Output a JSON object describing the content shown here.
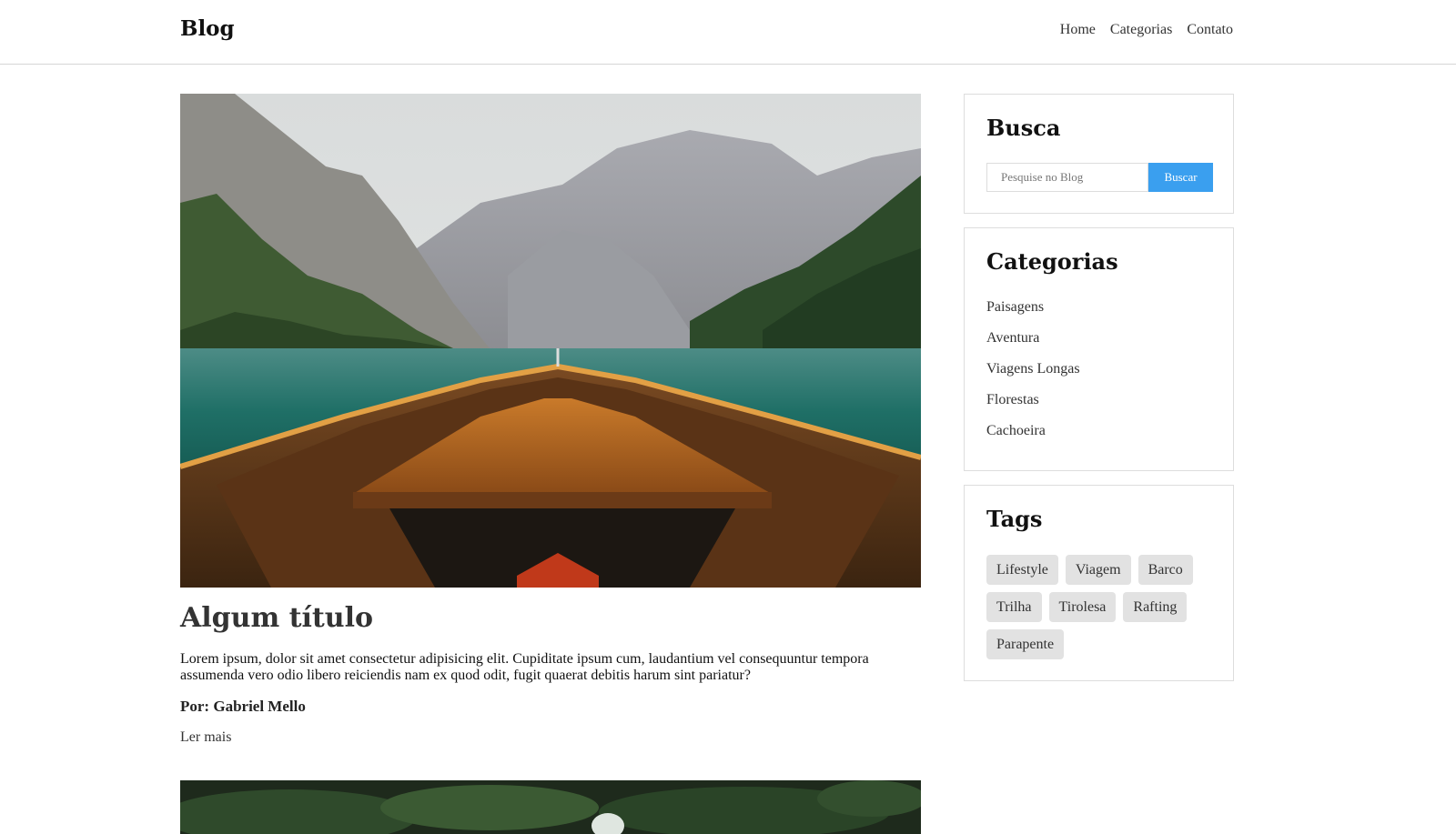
{
  "header": {
    "logo": "Blog",
    "nav": [
      "Home",
      "Categorias",
      "Contato"
    ]
  },
  "post": {
    "title": "Algum título",
    "body": "Lorem ipsum, dolor sit amet consectetur adipisicing elit. Cupiditate ipsum cum, laudantium vel consequuntur tempora assumenda vero odio libero reiciendis nam ex quod odit, fugit quaerat debitis harum sint pariatur?",
    "author": "Por: Gabriel Mello",
    "read_more": "Ler mais"
  },
  "sidebar": {
    "search": {
      "title": "Busca",
      "placeholder": "Pesquise no Blog",
      "button": "Buscar"
    },
    "categories": {
      "title": "Categorias",
      "items": [
        "Paisagens",
        "Aventura",
        "Viagens Longas",
        "Florestas",
        "Cachoeira"
      ]
    },
    "tags": {
      "title": "Tags",
      "items": [
        "Lifestyle",
        "Viagem",
        "Barco",
        "Trilha",
        "Tirolesa",
        "Rafting",
        "Parapente"
      ]
    }
  },
  "colors": {
    "accent": "#3a9fef",
    "tag_bg": "#e2e2e2",
    "border": "#dddddd"
  }
}
